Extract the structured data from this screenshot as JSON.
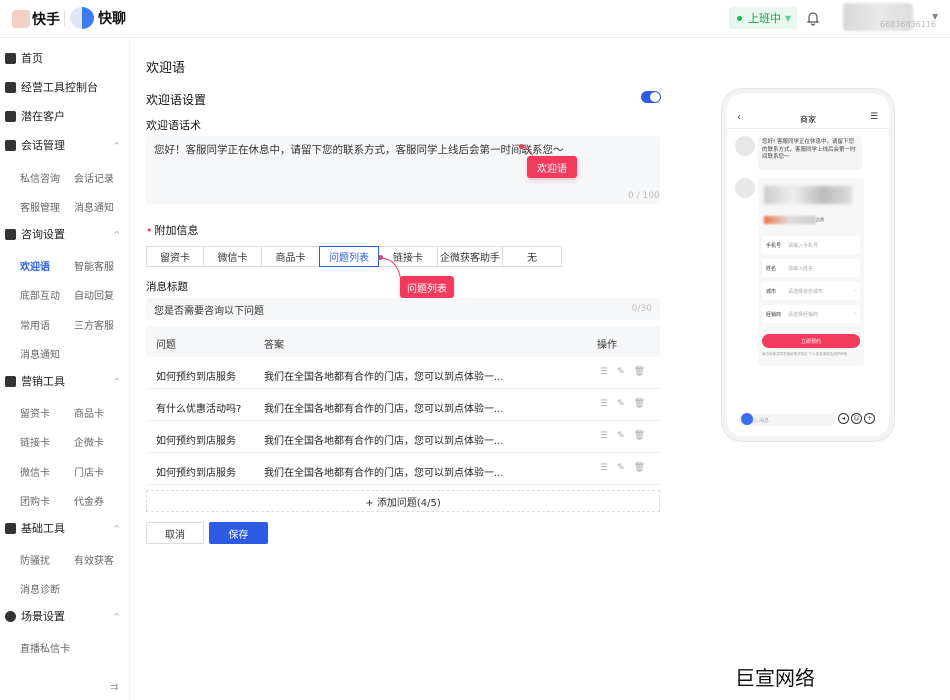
{
  "header": {
    "brand_kuaishou": "快手",
    "brand_kuailiao": "快聊",
    "status_label": "上班中",
    "user_id": "66836836116"
  },
  "sidebar": {
    "groups": [
      {
        "label": "首页"
      },
      {
        "label": "经营工具控制台"
      },
      {
        "label": "潜在客户"
      },
      {
        "label": "会话管理",
        "subs": [
          "私信咨询",
          "会话记录",
          "客服管理",
          "消息通知"
        ]
      },
      {
        "label": "咨询设置",
        "subs": [
          "欢迎语",
          "智能客服",
          "底部互动",
          "自动回复",
          "常用语",
          "三方客服",
          "消息通知"
        ]
      },
      {
        "label": "营销工具",
        "subs": [
          "留资卡",
          "商品卡",
          "链接卡",
          "企微卡",
          "微信卡",
          "门店卡",
          "团购卡",
          "代金券"
        ]
      },
      {
        "label": "基础工具",
        "subs": [
          "防骚扰",
          "有效获客",
          "消息诊断"
        ]
      },
      {
        "label": "场景设置",
        "subs": [
          "直播私信卡"
        ]
      }
    ]
  },
  "main": {
    "page_title": "欢迎语",
    "section_title": "欢迎语设置",
    "script_label": "欢迎语话术",
    "script_value": "您好！客服同学正在休息中，请留下您的联系方式，客服同学上线后会第一时间联系您～",
    "script_count": "0 / 100",
    "callout_welcome": "欢迎语",
    "extra_label": "附加信息",
    "tabs": [
      "留资卡",
      "微信卡",
      "商品卡",
      "问题列表",
      "链接卡",
      "企微获客助手",
      "无"
    ],
    "callout_tab": "问题列表",
    "msg_title_label": "消息标题",
    "msg_title_value": "您是否需要咨询以下问题",
    "msg_title_count": "0/30",
    "table": {
      "headers": [
        "问题",
        "答案",
        "操作"
      ],
      "rows": [
        {
          "q": "如何预约到店服务",
          "a": "我们在全国各地都有合作的门店，您可以到点体验一..."
        },
        {
          "q": "有什么优惠活动吗?",
          "a": "我们在全国各地都有合作的门店，您可以到点体验一..."
        },
        {
          "q": "如何预约到店服务",
          "a": "我们在全国各地都有合作的门店，您可以到点体验一..."
        },
        {
          "q": "如何预约到店服务",
          "a": "我们在全国各地都有合作的门店，您可以到点体验一..."
        }
      ]
    },
    "add_row": "+ 添加问题(4/5)",
    "cancel": "取消",
    "save": "保存"
  },
  "phone": {
    "title": "商家",
    "bubble": "您好! 客服同学正在休息中，请留下您的联系方式，客服同学上线后会第一时间联系您～",
    "chip": "品牌",
    "fields": [
      {
        "k": "手机号",
        "v": "请输入手机号",
        "arrow": false
      },
      {
        "k": "姓名",
        "v": "请输入姓名",
        "arrow": false
      },
      {
        "k": "城市",
        "v": "请选择省份城市",
        "arrow": true
      },
      {
        "k": "经销商",
        "v": "请选择经销商",
        "arrow": true
      }
    ],
    "cta": "立即预约",
    "note": "我已阅读并同意使用相关协议  个人信息授权及保护声明",
    "input_placeholder": "输入消息"
  },
  "watermark": "巨宣网络",
  "colors": {
    "primary": "#2d5be3",
    "accent": "#f23b5c",
    "status_green": "#1a9e4b"
  }
}
